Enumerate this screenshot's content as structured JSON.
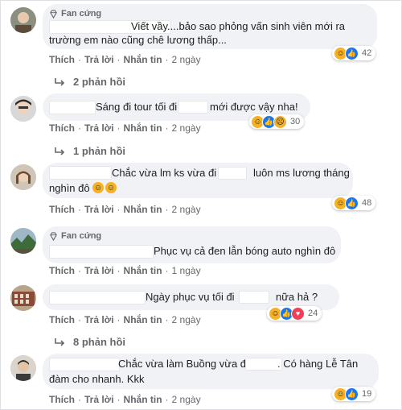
{
  "fan_badge": "Fan cứng",
  "actions": {
    "like": "Thích",
    "reply": "Trả lời",
    "message": "Nhắn tin",
    "sep": "·"
  },
  "comments": [
    {
      "line1": "Viết vầy....bảo sao phỏng vấn sinh viên mới ra",
      "line2": "trường em nào cũng chê lương thấp...",
      "time": "2 ngày",
      "reactions": [
        "haha",
        "like"
      ],
      "count": "42",
      "replies": "2 phản hồi"
    },
    {
      "part1": "Sáng đi tour tối đi l",
      "part2": "mới được vậy nha!",
      "time": "2 ngày",
      "reactions": [
        "haha",
        "like",
        "sad"
      ],
      "count": "30",
      "replies": "1 phản hồi"
    },
    {
      "line1": "Chắc vừa lm ks vừa đi",
      "line1b": "luôn ms lương tháng",
      "line2": "nghìn đô",
      "time": "2 ngày",
      "reactions": [
        "haha",
        "like"
      ],
      "count": "48"
    },
    {
      "line1": "Phục vụ cả đen lẫn bóng auto nghìn đô",
      "time": "1 ngày"
    },
    {
      "part1": "Ngày phục vụ tối đi",
      "part2": "nữa hả ?",
      "time": "2 ngày",
      "reactions": [
        "haha",
        "like",
        "love"
      ],
      "count": "24",
      "replies": "8 phản hồi"
    },
    {
      "line1": "Chắc vừa làm Buồng vừa đi",
      "line1b": ". Có hàng Lễ Tân",
      "line2": "đàm cho nhanh. Kkk",
      "time": "2 ngày",
      "reactions": [
        "haha",
        "like"
      ],
      "count": "19"
    }
  ],
  "icons": {
    "badge": "diamond-icon",
    "reply_arrow": "reply-arrow-icon",
    "haha": "haha-reaction-icon",
    "like": "like-reaction-icon",
    "sad": "sad-reaction-icon",
    "love": "love-reaction-icon"
  },
  "colors": {
    "bubble": "#f0f2f5",
    "meta": "#65676b",
    "like": "#1877f2",
    "haha": "#f7b125",
    "love": "#f33e58"
  }
}
